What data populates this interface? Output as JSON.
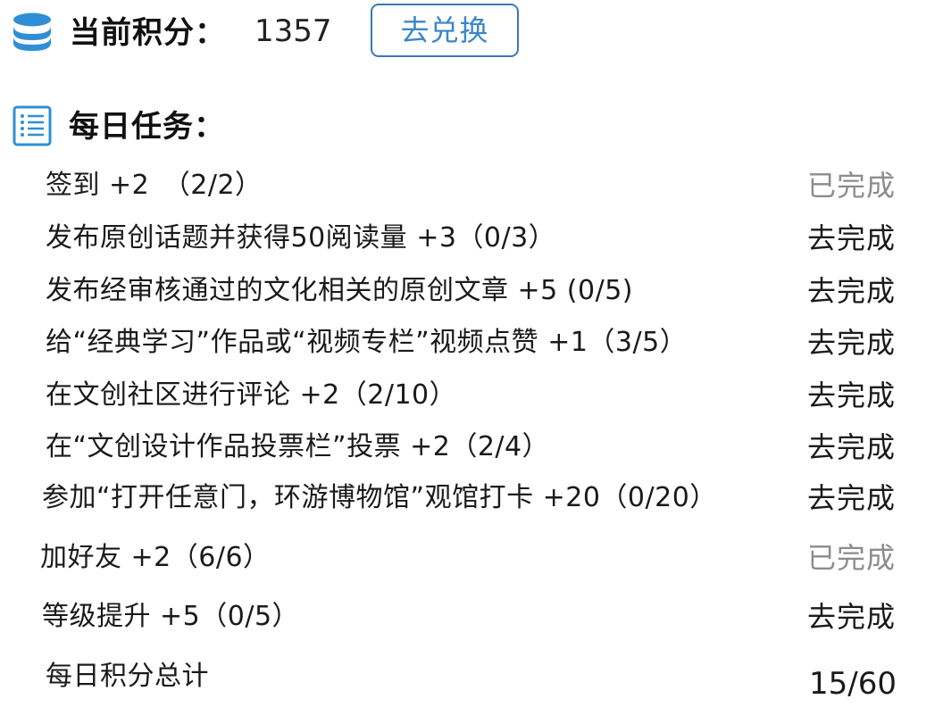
{
  "points": {
    "label": "当前积分：",
    "value": "1357",
    "redeem_label": "去兑换"
  },
  "tasks_header": {
    "title": "每日任务："
  },
  "tasks": [
    {
      "label": "签到 +2　（2/2）",
      "status": "已完成",
      "state": "done"
    },
    {
      "label": "发布原创话题并获得50阅读量 +3（0/3）",
      "status": "去完成",
      "state": "todo"
    },
    {
      "label": "发布经审核通过的文化相关的原创文章 +5 (0/5)",
      "status": "去完成",
      "state": "todo"
    },
    {
      "label": "给“经典学习”作品或“视频专栏”视频点赞 +1（3/5）",
      "status": "去完成",
      "state": "todo"
    },
    {
      "label": "在文创社区进行评论 +2（2/10）",
      "status": "去完成",
      "state": "todo"
    },
    {
      "label": "在“文创设计作品投票栏”投票 +2（2/4）",
      "status": "去完成",
      "state": "todo"
    },
    {
      "label": "参加“打开任意门，环游博物馆”观馆打卡 +20（0/20）",
      "status": "去完成",
      "state": "todo"
    },
    {
      "label": "加好友 +2（6/6）",
      "status": "已完成",
      "state": "done"
    },
    {
      "label": "等级提升 +5（0/5）",
      "status": "去完成",
      "state": "todo"
    }
  ],
  "total": {
    "label": "每日积分总计",
    "value": "15/60"
  },
  "icons": {
    "points": "database-stack-icon",
    "tasks": "task-list-icon"
  },
  "colors": {
    "accent": "#2f8fd6",
    "button_border": "#3a79b5",
    "done_status": "#8c8c8c"
  }
}
